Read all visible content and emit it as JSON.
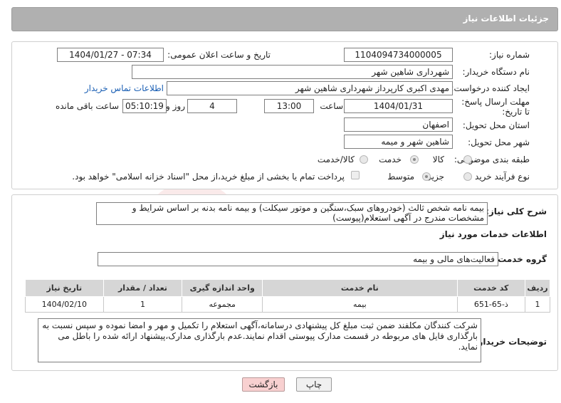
{
  "header": {
    "title": "جزئیات اطلاعات نیاز"
  },
  "need_number": {
    "label": "شماره نیاز:",
    "value": "1104094734000005"
  },
  "announce": {
    "label": "تاریخ و ساعت اعلان عمومی:",
    "value": "1404/01/27 - 07:34"
  },
  "buyer_org": {
    "label": "نام دستگاه خریدار:",
    "value": "شهرداری شاهین شهر"
  },
  "creator": {
    "label": "ایجاد کننده درخواست:",
    "value": "مهدی اکبری کارپرداز شهرداری شاهین شهر",
    "contact_link": "اطلاعات تماس خریدار"
  },
  "deadline": {
    "label": "مهلت ارسال پاسخ: تا تاریخ:",
    "date": "1404/01/31",
    "time_label": "ساعت",
    "time": "13:00",
    "days": "4",
    "days_label": "روز و",
    "remaining": "05:10:19",
    "remaining_label": "ساعت باقی مانده"
  },
  "province": {
    "label": "استان محل تحویل:",
    "value": "اصفهان"
  },
  "city": {
    "label": "شهر محل تحویل:",
    "value": "شاهین شهر و میمه"
  },
  "category": {
    "label": "طبقه بندی موضوعی:",
    "options": [
      "کالا",
      "خدمت",
      "کالا/خدمت"
    ],
    "selected": "خدمت"
  },
  "process": {
    "label": "نوع فرآیند خرید :",
    "options": [
      "جزیی",
      "متوسط"
    ],
    "selected": "متوسط",
    "payment_note": "پرداخت تمام یا بخشی از مبلغ خرید،از محل \"اسناد خزانه اسلامی\" خواهد بود."
  },
  "description": {
    "label": "شرح کلی نیاز:",
    "value": "بیمه نامه شخص ثالث (خودروهای سبک،سنگین و موتور سیکلت) و بیمه نامه بدنه بر اساس شرایط و مشخصات مندرج در آگهی استعلام(پیوست)"
  },
  "services": {
    "section_title": "اطلاعات خدمات مورد نیاز",
    "group_label": "گروه خدمت:",
    "group_value": "فعالیت‌های مالی و بیمه",
    "columns": [
      "ردیف",
      "کد خدمت",
      "نام خدمت",
      "واحد اندازه گیری",
      "تعداد / مقدار",
      "تاریخ نیاز"
    ],
    "rows": [
      {
        "row": "1",
        "code": "ذ-65-651",
        "name": "بیمه",
        "unit": "مجموعه",
        "qty": "1",
        "date": "1404/02/10"
      }
    ]
  },
  "buyer_notes": {
    "label": "توضیحات خریدار:",
    "value": "شرکت کنندگان مکلفند ضمن ثبت مبلغ کل پیشنهادی درسامانه،آگهی استعلام را تکمیل و مهر و امضا نموده و سپس نسبت به بارگذاری فایل های مربوطه در قسمت مدارک پیوستی اقدام نمایند.عدم بارگذاری مدارک،پیشنهاد ارائه شده را باطل می نماید."
  },
  "buttons": {
    "print": "چاپ",
    "back": "بازگشت"
  }
}
